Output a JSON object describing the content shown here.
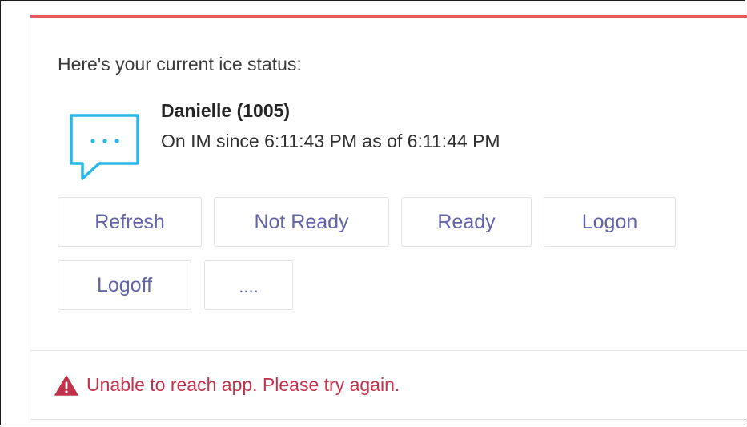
{
  "message": {
    "intro": "Here's your current ice status:"
  },
  "status": {
    "icon": "chat-bubble-ellipsis-icon",
    "icon_color": "#29b6e8",
    "name": "Danielle (1005)",
    "detail": "On IM since 6:11:43 PM as of 6:11:44 PM"
  },
  "actions": {
    "refresh": "Refresh",
    "not_ready": "Not Ready",
    "ready": "Ready",
    "logon": "Logon",
    "logoff": "Logoff",
    "more": "...."
  },
  "error": {
    "icon": "warning-triangle-icon",
    "text": "Unable to reach app. Please try again.",
    "color": "#c4314b"
  },
  "colors": {
    "accent_top_bar": "#e5595f",
    "button_text": "#6264a7"
  }
}
